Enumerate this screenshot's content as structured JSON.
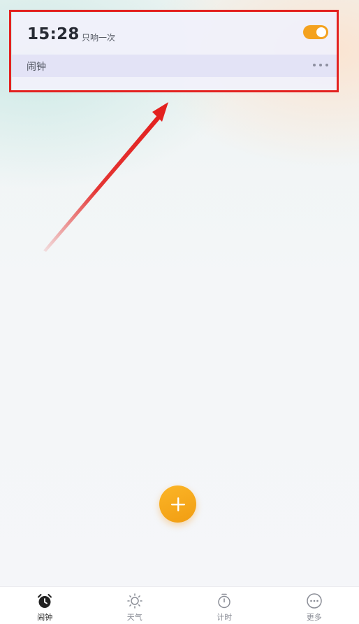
{
  "alarm": {
    "time": "15:28",
    "repeat": "只响一次",
    "label": "闹钟",
    "enabled": true
  },
  "fab": {
    "icon": "plus-icon"
  },
  "nav": {
    "items": [
      {
        "label": "闹钟",
        "icon": "alarm-clock-icon",
        "active": true
      },
      {
        "label": "天气",
        "icon": "sun-icon",
        "active": false
      },
      {
        "label": "计时",
        "icon": "stopwatch-icon",
        "active": false
      },
      {
        "label": "更多",
        "icon": "more-icon",
        "active": false
      }
    ]
  },
  "colors": {
    "accent": "#f4a21f",
    "highlight": "#e3211f",
    "active_nav": "#222222",
    "inactive_nav": "#8a8d96"
  }
}
